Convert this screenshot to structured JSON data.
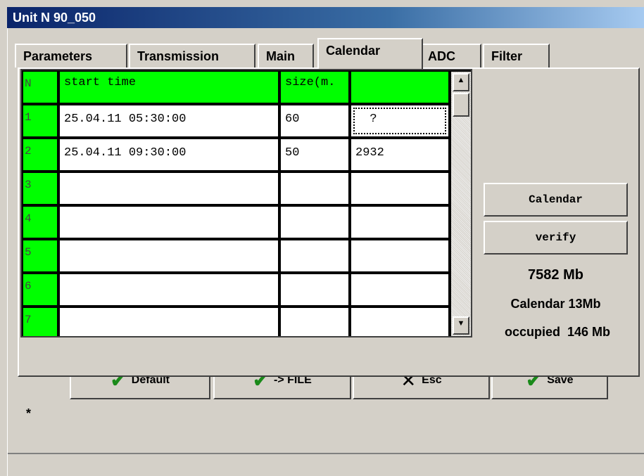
{
  "window": {
    "title": "Unit  N 90_050"
  },
  "tabs": [
    {
      "label": "Parameters"
    },
    {
      "label": "Transmission"
    },
    {
      "label": "Main"
    },
    {
      "label": "Calendar"
    },
    {
      "label": "ADC"
    },
    {
      "label": "Filter"
    }
  ],
  "table": {
    "headers": [
      "N",
      "start time",
      "size(m.",
      ""
    ],
    "rows": [
      {
        "n": "1",
        "start": "25.04.11 05:30:00",
        "size": "60",
        "val": "  ?"
      },
      {
        "n": "2",
        "start": "25.04.11 09:30:00",
        "size": "50",
        "val": "2932"
      },
      {
        "n": "3",
        "start": "",
        "size": "",
        "val": ""
      },
      {
        "n": "4",
        "start": "",
        "size": "",
        "val": ""
      },
      {
        "n": "5",
        "start": "",
        "size": "",
        "val": ""
      },
      {
        "n": "6",
        "start": "",
        "size": "",
        "val": ""
      },
      {
        "n": "7",
        "start": "",
        "size": "",
        "val": ""
      }
    ]
  },
  "side": {
    "calendar_btn": "Calendar",
    "verify_btn": "verify",
    "memory": "7582 Mb",
    "calendar_size": "Calendar 13Mb",
    "occupied": "occupied  146 Mb"
  },
  "buttons": {
    "default": "Default",
    "file": "-> FILE",
    "esc": "Esc",
    "save": "Save"
  },
  "marker": "*",
  "icons": {
    "check": "check-icon",
    "close": "close-icon",
    "up": "arrow-up-icon",
    "down": "arrow-down-icon"
  }
}
